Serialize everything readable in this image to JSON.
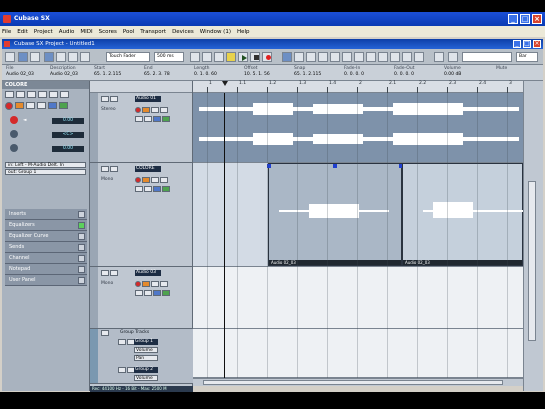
{
  "window": {
    "title": "Cubase SX"
  },
  "menu": [
    "File",
    "Edit",
    "Project",
    "Audio",
    "MIDI",
    "Scores",
    "Pool",
    "Transport",
    "Devices",
    "Window (1)",
    "Help"
  ],
  "project": {
    "title": "Cubase SX Project - Untitled1"
  },
  "toolbar": {
    "mode_dropdown": "Touch Fader",
    "zoom_dropdown": "500 ms",
    "snap_label": "Bar"
  },
  "infoline": [
    {
      "header": "File",
      "value": "Audio 02_03"
    },
    {
      "header": "Description",
      "value": "Audio 02_03"
    },
    {
      "header": "Start",
      "value": "65. 1. 2.115"
    },
    {
      "header": "End",
      "value": "65. 2. 3. 78"
    },
    {
      "header": "Length",
      "value": "0. 1. 0. 60"
    },
    {
      "header": "Offset",
      "value": "10. 5. 1. 56"
    },
    {
      "header": "Snap",
      "value": "65. 1. 2.115"
    },
    {
      "header": "Fade-In",
      "value": "0. 0. 0. 0"
    },
    {
      "header": "Fade-Out",
      "value": "0. 0. 0. 0"
    },
    {
      "header": "Volume",
      "value": "0.00 dB"
    },
    {
      "header": "Mute",
      "value": ""
    }
  ],
  "inspector": {
    "track_name": "COLORE",
    "volume_value": "0.00",
    "pan_value": "<C>",
    "delay_value": "0.00",
    "input_routing": "in: Left - M-Audio Delt. In",
    "output_routing": "out: Group 1",
    "sections": [
      {
        "label": "Inserts",
        "on": false
      },
      {
        "label": "Equalizers",
        "on": true
      },
      {
        "label": "Equalizer Curve",
        "on": false
      },
      {
        "label": "Sends",
        "on": false
      },
      {
        "label": "Channel",
        "on": false
      },
      {
        "label": "Notepad",
        "on": false
      },
      {
        "label": "User Panel",
        "on": false
      }
    ]
  },
  "tracks": [
    {
      "name": "Audio 01",
      "label": "Stereo"
    },
    {
      "name": "COLORE",
      "label": "Mono"
    },
    {
      "name": "Audio 03",
      "label": "Mono"
    }
  ],
  "group_folder": {
    "label": "Group Tracks"
  },
  "groups": [
    {
      "name": "Group 1",
      "param1": "Volume",
      "param2": "Pan"
    },
    {
      "name": "Group 2",
      "param1": "Volume",
      "param2": ""
    }
  ],
  "ruler": {
    "labels": [
      "1",
      "1.1",
      "1.2",
      "1.3",
      "1.4",
      "2",
      "2.1",
      "2.2",
      "2.3",
      "2.4",
      "3"
    ]
  },
  "events": {
    "event_left": "Audio 02_03",
    "event_right": "Audio 02_03"
  },
  "status": {
    "text": "Rec: 44100 Hz - 16 Bit - Max: 2500 M"
  }
}
